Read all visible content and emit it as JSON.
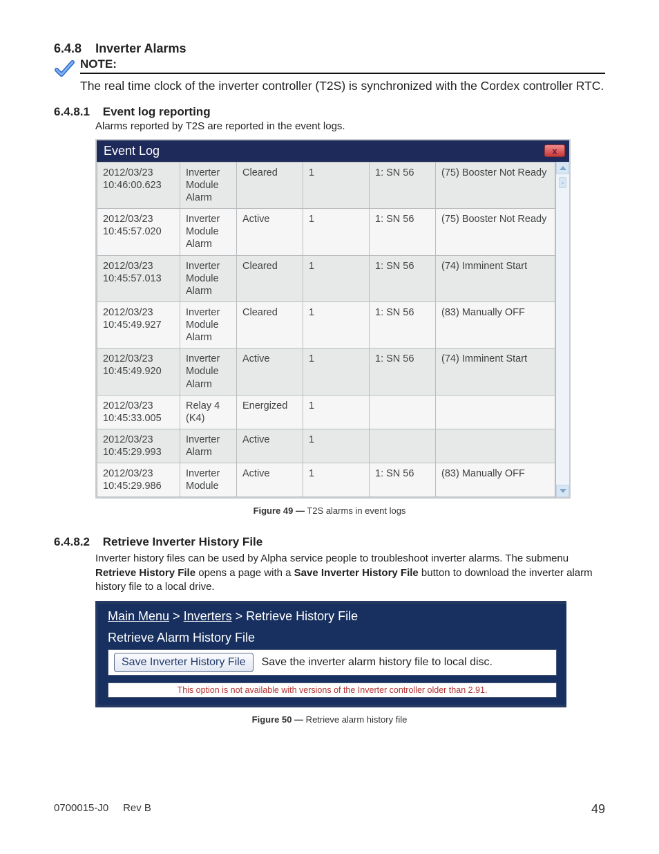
{
  "headings": {
    "h648_num": "6.4.8",
    "h648_title": "Inverter Alarms",
    "note_label": "NOTE:",
    "note_body": "The real time clock of the inverter controller (T2S) is synchronized with the Cordex controller RTC.",
    "h6481_num": "6.4.8.1",
    "h6481_title": "Event log reporting",
    "lead_6481": "Alarms reported by T2S are reported in the event logs.",
    "h6482_num": "6.4.8.2",
    "h6482_title": "Retrieve Inverter History File",
    "para_6482_pre": "Inverter history files can be used by Alpha service people to troubleshoot inverter alarms. The submenu ",
    "para_6482_b1": "Retrieve History File",
    "para_6482_mid": " opens a page with a ",
    "para_6482_b2": "Save Inverter History File",
    "para_6482_post": " button to download the inverter alarm history file to a local drive."
  },
  "eventlog": {
    "title": "Event Log",
    "close_glyph": "x",
    "rows": [
      {
        "ts": "2012/03/23 10:46:00.623",
        "type": "Inverter Module Alarm",
        "state": "Cleared",
        "id": "1",
        "sn": "1: SN 56",
        "desc": "(75) Booster Not Ready"
      },
      {
        "ts": "2012/03/23 10:45:57.020",
        "type": "Inverter Module Alarm",
        "state": "Active",
        "id": "1",
        "sn": "1: SN 56",
        "desc": "(75) Booster Not Ready"
      },
      {
        "ts": "2012/03/23 10:45:57.013",
        "type": "Inverter Module Alarm",
        "state": "Cleared",
        "id": "1",
        "sn": "1: SN 56",
        "desc": "(74) Imminent Start"
      },
      {
        "ts": "2012/03/23 10:45:49.927",
        "type": "Inverter Module Alarm",
        "state": "Cleared",
        "id": "1",
        "sn": "1: SN 56",
        "desc": "(83) Manually OFF"
      },
      {
        "ts": "2012/03/23 10:45:49.920",
        "type": "Inverter Module Alarm",
        "state": "Active",
        "id": "1",
        "sn": "1: SN 56",
        "desc": "(74) Imminent Start"
      },
      {
        "ts": "2012/03/23 10:45:33.005",
        "type": "Relay 4 (K4)",
        "state": "Energized",
        "id": "1",
        "sn": "",
        "desc": ""
      },
      {
        "ts": "2012/03/23 10:45:29.993",
        "type": "Inverter Alarm",
        "state": "Active",
        "id": "1",
        "sn": "",
        "desc": ""
      },
      {
        "ts": "2012/03/23 10:45:29.986",
        "type": "Inverter Module",
        "state": "Active",
        "id": "1",
        "sn": "1: SN 56",
        "desc": "(83) Manually OFF"
      }
    ]
  },
  "fig49": {
    "label": "Figure 49 —",
    "text": "  T2S alarms in event logs"
  },
  "retrieve": {
    "breadcrumbs": [
      "Main Menu",
      "Inverters",
      "Retrieve History File"
    ],
    "bc_sep": " > ",
    "section_title": "Retrieve Alarm History File",
    "save_button_label": "Save Inverter History File",
    "save_desc": "Save the inverter alarm history file to local disc.",
    "disclaimer": "This option is not available with versions of the Inverter controller older than 2.91."
  },
  "fig50": {
    "label": "Figure 50 —",
    "text": "  Retrieve alarm history file"
  },
  "footer": {
    "docid": "0700015-J0",
    "rev": "Rev B",
    "page": "49"
  }
}
